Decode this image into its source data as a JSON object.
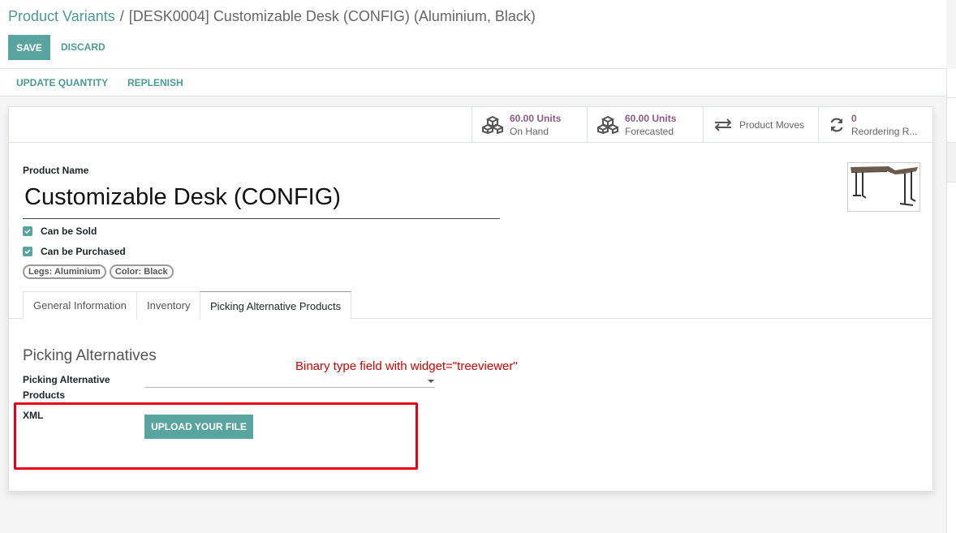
{
  "breadcrumb": {
    "parent": "Product Variants",
    "separator": "/",
    "current": "[DESK0004] Customizable Desk (CONFIG) (Aluminium, Black)"
  },
  "actions": {
    "save": "SAVE",
    "discard": "DISCARD"
  },
  "statusbar": {
    "update_quantity": "UPDATE QUANTITY",
    "replenish": "REPLENISH"
  },
  "smart_buttons": [
    {
      "value": "60.00 Units",
      "label": "On Hand",
      "icon": "cubes-icon"
    },
    {
      "value": "60.00 Units",
      "label": "Forecasted",
      "icon": "cubes-icon"
    },
    {
      "value": "",
      "label": "Product Moves",
      "icon": "exchange-icon"
    },
    {
      "value": "0",
      "label": "Reordering R...",
      "icon": "refresh-icon"
    }
  ],
  "form": {
    "product_name_label": "Product Name",
    "product_name": "Customizable Desk (CONFIG)",
    "can_be_sold": "Can be Sold",
    "can_be_purchased": "Can be Purchased",
    "attributes": [
      "Legs: Aluminium",
      "Color: Black"
    ]
  },
  "tabs": [
    {
      "label": "General Information",
      "active": false
    },
    {
      "label": "Inventory",
      "active": false
    },
    {
      "label": "Picking Alternative Products",
      "active": true
    }
  ],
  "picking": {
    "section_title": "Picking Alternatives",
    "alt_products_label_1": "Picking Alternative",
    "alt_products_label_2": "Products",
    "xml_label": "XML",
    "upload_button": "UPLOAD YOUR FILE",
    "annotation": "Binary type field with widget=\"treeviewer\""
  },
  "colors": {
    "accent": "#5aa49f",
    "link": "#4a9a95",
    "value": "#8d5a83",
    "annotation": "#d40000"
  }
}
